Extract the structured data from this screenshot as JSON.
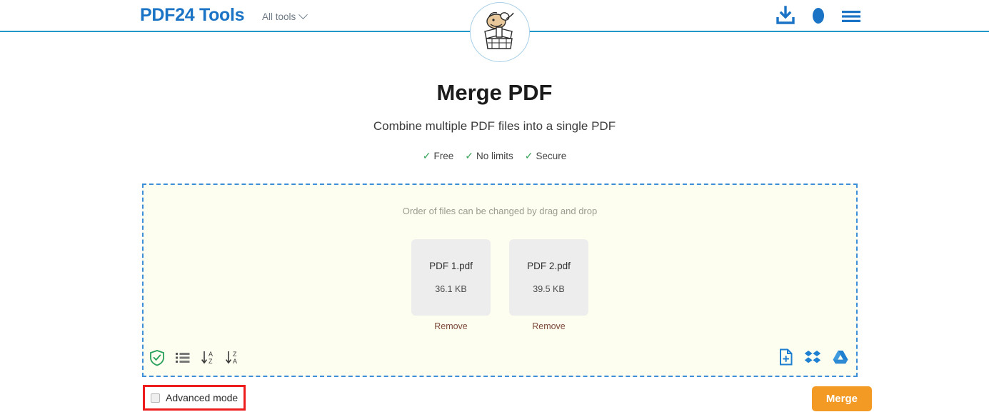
{
  "header": {
    "brand": "PDF24 Tools",
    "all_tools_label": "All tools",
    "icons": [
      {
        "name": "download-icon",
        "label": "Download"
      },
      {
        "name": "user-icon",
        "label": "Account"
      },
      {
        "name": "hamburger-menu-icon",
        "label": "Menu"
      }
    ],
    "mascot_alt": "PDF24 mascot",
    "accent_color": "#1a73c4",
    "divider_color": "#2196c9"
  },
  "hero": {
    "title": "Merge PDF",
    "subtitle": "Combine multiple PDF files into a single PDF",
    "features": [
      {
        "check": "✓",
        "label": "Free"
      },
      {
        "check": "✓",
        "label": "No limits"
      },
      {
        "check": "✓",
        "label": "Secure"
      }
    ],
    "check_color": "#3aa35a"
  },
  "dropzone": {
    "hint": "Order of files can be changed by drag and drop",
    "background_color": "#fdfdf0",
    "border_color": "#3f8fd8",
    "files": [
      {
        "name": "PDF 1.pdf",
        "size": "36.1 KB",
        "remove_label": "Remove"
      },
      {
        "name": "PDF 2.pdf",
        "size": "39.5 KB",
        "remove_label": "Remove"
      }
    ],
    "tools_left": [
      {
        "name": "shield-check-icon",
        "label": "Secure"
      },
      {
        "name": "list-icon",
        "label": "List view"
      },
      {
        "name": "sort-a-z-icon",
        "label": "Sort A to Z"
      },
      {
        "name": "sort-z-a-icon",
        "label": "Sort Z to A"
      }
    ],
    "tools_right": [
      {
        "name": "add-file-icon",
        "label": "Add file"
      },
      {
        "name": "dropbox-icon",
        "label": "Dropbox"
      },
      {
        "name": "google-drive-icon",
        "label": "Google Drive"
      }
    ]
  },
  "footer": {
    "advanced_mode_label": "Advanced mode",
    "advanced_mode_checked": false,
    "merge_label": "Merge",
    "merge_color": "#f39a25",
    "highlight_color": "#ee1d1d"
  }
}
